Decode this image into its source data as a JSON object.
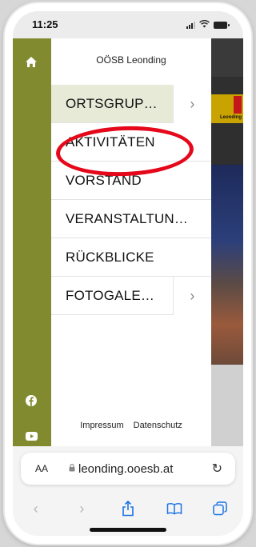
{
  "status_bar": {
    "time": "11:25"
  },
  "rail": {
    "icons": [
      "home-icon",
      "facebook-icon",
      "youtube-icon"
    ]
  },
  "background_site": {
    "logo_label": "Leonding"
  },
  "drawer": {
    "title": "OÖSB Leonding",
    "items": [
      {
        "label": "ORTSGRUP…",
        "has_submenu": true,
        "active": true
      },
      {
        "label": "AKTIVITÄTEN",
        "has_submenu": false,
        "active": false
      },
      {
        "label": "VORSTAND",
        "has_submenu": false,
        "active": false
      },
      {
        "label": "VERANSTALTUN…",
        "has_submenu": false,
        "active": false
      },
      {
        "label": "RÜCKBLICKE",
        "has_submenu": false,
        "active": false
      },
      {
        "label": "FOTOGALE…",
        "has_submenu": true,
        "active": false
      }
    ],
    "footer": {
      "impressum": "Impressum",
      "datenschutz": "Datenschutz"
    }
  },
  "safari": {
    "aa_label": "AA",
    "url": "leonding.ooesb.at",
    "toolbar_icons": [
      "back-icon",
      "forward-icon",
      "share-icon",
      "bookmarks-icon",
      "tabs-icon"
    ]
  },
  "colors": {
    "rail": "#828a2f",
    "highlight": "#e5081b",
    "active_item_bg": "#e8ead8",
    "safari_blue": "#1a73e8"
  }
}
